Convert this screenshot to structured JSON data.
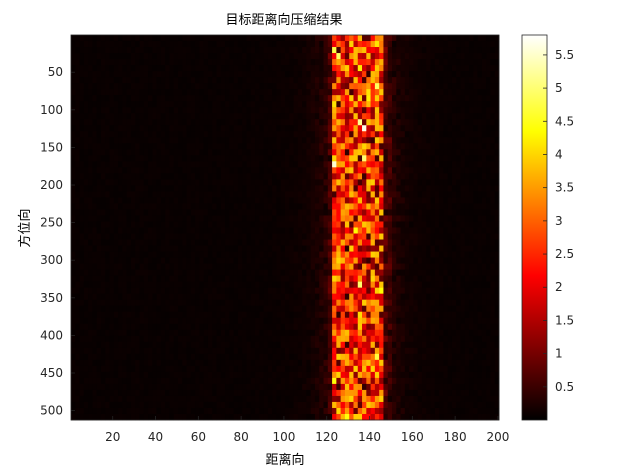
{
  "chart_data": {
    "type": "heatmap",
    "title": "目标距离向压缩结果",
    "xlabel": "距离向",
    "ylabel": "方位向",
    "xlim": [
      1,
      200
    ],
    "ylim": [
      1,
      512
    ],
    "y_reversed": true,
    "xticks": [
      20,
      40,
      60,
      80,
      100,
      120,
      140,
      160,
      180,
      200
    ],
    "yticks": [
      50,
      100,
      150,
      200,
      250,
      300,
      350,
      400,
      450,
      500
    ],
    "colormap": "hot",
    "colorbar": {
      "clim": [
        0,
        5.8
      ],
      "ticks": [
        0.5,
        1,
        1.5,
        2,
        2.5,
        3,
        3.5,
        4,
        4.5,
        5,
        5.5
      ]
    },
    "grid": false,
    "features": [
      {
        "description": "bright target band",
        "x_range": [
          123,
          147
        ],
        "peak_value": 5.8
      },
      {
        "description": "dark background",
        "typical_value": 0.05
      }
    ]
  }
}
